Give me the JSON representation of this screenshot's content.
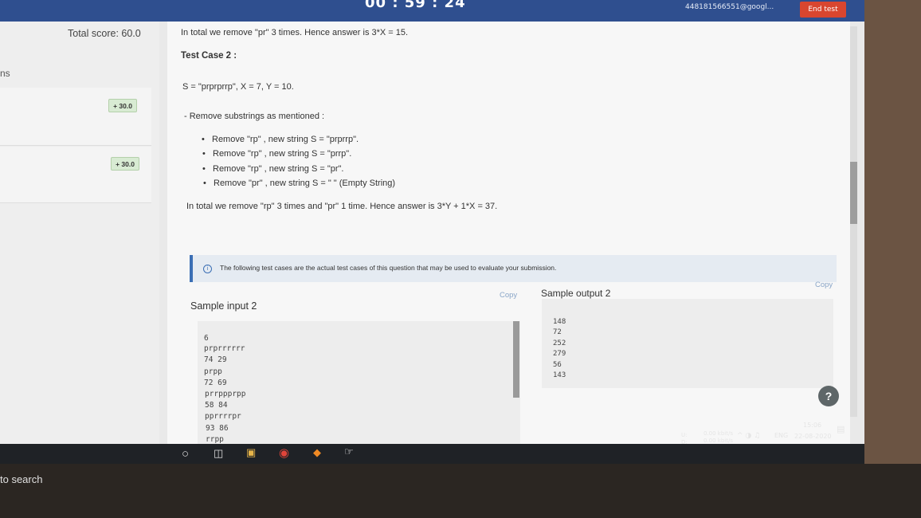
{
  "header": {
    "timer": "00 : 59 : 24",
    "email": "448181566551@googl...",
    "end_test": "End test"
  },
  "sidebar": {
    "total_score": "Total score: 60.0",
    "partial_label": "ns",
    "badges": [
      "+ 30.0",
      "+ 30.0"
    ]
  },
  "main": {
    "line1": "In total we remove \"pr\" 3 times. Hence answer is 3*X = 15.",
    "test_case_2": "Test Case 2 :",
    "s_line": "S = \"prprprrp\", X = 7, Y = 10.",
    "remove_intro": "- Remove substrings as mentioned :",
    "steps": [
      "Remove \"rp\" , new string S = \"prprrp\".",
      "Remove \"rp\" , new string S = \"prrp\".",
      "Remove \"rp\" , new string S = \"pr\".",
      "Remove \"pr\" , new string S = \" \" (Empty String)"
    ],
    "total2": "In total we remove \"rp\" 3 times and \"pr\" 1 time. Hence answer is 3*Y + 1*X = 37.",
    "info": "The following test cases are the actual test cases of this question that may be used to evaluate your submission.",
    "sample_input_title": "Sample input 2",
    "sample_output_title": "Sample output 2",
    "copy_label": "Copy",
    "input_lines": [
      "6",
      "prprrrrrr",
      "74 29",
      "prpp",
      "72 69",
      "prrppprpp",
      "58 84",
      "pprrrrpr",
      "93 86",
      "rrpp"
    ],
    "output_lines": [
      "148",
      "72",
      "252",
      "279",
      "56",
      "143"
    ],
    "help_label": "?"
  },
  "taskbar": {
    "search": "to search",
    "upload": "0.00 kbit/s",
    "download": "0.00 kbit/s",
    "u": "U:",
    "d": "D:",
    "lang": "ENG",
    "time": "15:06",
    "date": "22-08-2020"
  }
}
